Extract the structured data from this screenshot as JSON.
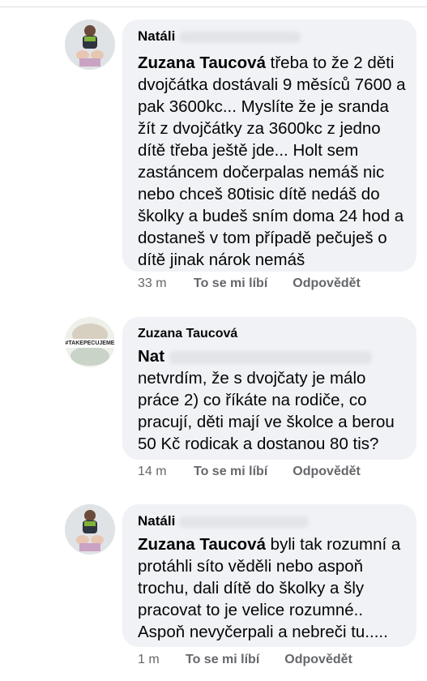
{
  "comments": [
    {
      "author": "Natáli",
      "mention": "Zuzana Taucová",
      "text": " třeba to že 2 děti dvojčátka dostávali 9 měsíců 7600 a pak 3600kc... Myslíte že je sranda žít z dvojčátky za 3600kc z jedno dítě třeba ještě jde... Holt sem zastáncem dočerpalas nemáš nic nebo chceš 80tisic dítě nedáš do školky a budeš sním doma 24 hod a dostaneš v tom případě pečuješ o dítě jinak nárok nemáš",
      "time": "33 m",
      "like": "To se mi líbí",
      "reply": "Odpovědět"
    },
    {
      "author": "Zuzana Taucová",
      "mention": "Nat",
      "text": "netvrdím, že s dvojčaty je málo práce 2) co říkáte na rodiče, co pracují, děti mají ve školce a berou 50 Kč rodicak a dostanou 80 tis?",
      "time": "14 m",
      "like": "To se mi líbí",
      "reply": "Odpovědět",
      "avatar_text": "#TAKEPECUJEME"
    },
    {
      "author": "Natáli",
      "mention": "Zuzana Taucová",
      "text": " byli tak rozumní a protáhli síto věděli nebo aspoň trochu, dali dítě do školky a šly pracovat to je velice rozumné.. Aspoň nevyčerpali a nebreči tu.....",
      "time": "1 m",
      "like": "To se mi líbí",
      "reply": "Odpovědět"
    }
  ]
}
